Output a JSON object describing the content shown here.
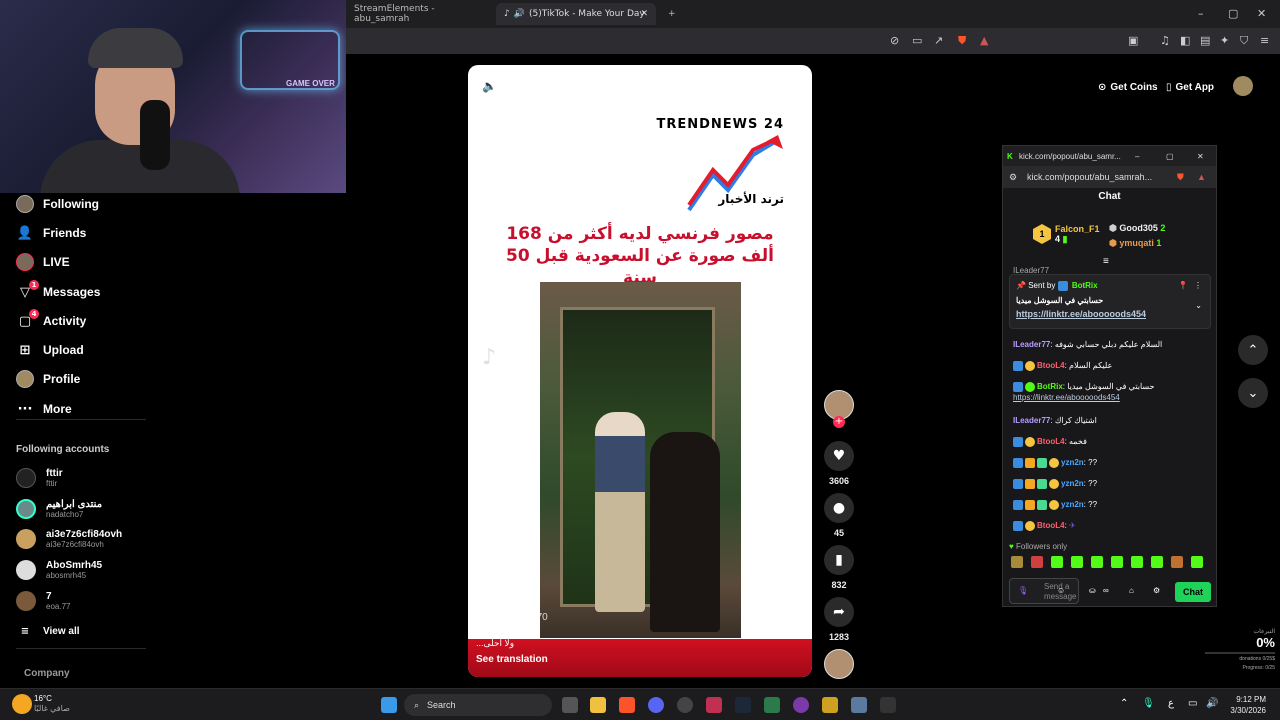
{
  "browser": {
    "tabs": [
      {
        "label": "StreamElements - abu_samrah"
      },
      {
        "label": "(5)TikTok - Make Your Day"
      }
    ],
    "add_tab": "+"
  },
  "webcam": {
    "overlay_text": "GAME OVER"
  },
  "sidebar": {
    "items": [
      {
        "label": "Following",
        "icon": "avatar-icon"
      },
      {
        "label": "Friends",
        "icon": "friends-icon"
      },
      {
        "label": "LIVE",
        "icon": "live-icon"
      },
      {
        "label": "Messages",
        "icon": "messages-icon",
        "badge": "1"
      },
      {
        "label": "Activity",
        "icon": "activity-icon",
        "badge": "4"
      },
      {
        "label": "Upload",
        "icon": "upload-icon"
      },
      {
        "label": "Profile",
        "icon": "profile-icon"
      },
      {
        "label": "More",
        "icon": "more-icon"
      }
    ],
    "following_title": "Following accounts",
    "accounts": [
      {
        "name": "fttir",
        "handle": "fttir"
      },
      {
        "name": "منتدى ابراهيم",
        "handle": "nadatcho7"
      },
      {
        "name": "ai3e7z6cfi84ovh",
        "handle": "ai3e7z6cfi84ovh"
      },
      {
        "name": "AboSmrh45",
        "handle": "abosmrh45"
      },
      {
        "name": "7",
        "handle": "eoa.77"
      }
    ],
    "view_all": "View all",
    "company": "Company"
  },
  "video": {
    "brand": "TRENDNEWS 24",
    "brand_ar": "ترند الأخبار",
    "headline": "مصور فرنسي لديه أكثر من 168 ألف صورة عن السعودية قبل 50 سنة",
    "caption": "...ولا احلى",
    "watermark": "abu_dommes70",
    "see_translation": "See translation"
  },
  "actions": {
    "likes": "3606",
    "comments": "45",
    "saves": "832",
    "shares": "1283"
  },
  "topbar": {
    "get_coins": "Get Coins",
    "get_app": "Get App"
  },
  "chat": {
    "window_title": "kick.com/popout/abu_samr...",
    "url": "kick.com/popout/abu_samrah...",
    "header": "Chat",
    "leaderboard": [
      {
        "name": "Falcon_F1",
        "count": "4",
        "color": "#f5c542"
      },
      {
        "name": "Good305",
        "count": "2",
        "color": "#cfcfcf"
      },
      {
        "name": "ymuqati",
        "count": "1",
        "color": "#e89a4a"
      }
    ],
    "scrolled_text": "ILeader77",
    "pinned": {
      "sent_by_label": "Sent by",
      "sender": "BotRix",
      "text": "حسابتي في السوشل ميديا",
      "link": "https://linktr.ee/abooooods454"
    },
    "messages": [
      {
        "user": "ILeader77",
        "color": "#b89cff",
        "text": "السلام عليكم دبلي حسابي شوفه"
      },
      {
        "user": "BtooL4",
        "color": "#ff5f6d",
        "text": "عليكم السلام"
      },
      {
        "user": "BotRix",
        "color": "#53fc18",
        "text": "حسابتي في السوشل ميديا",
        "link": "https://linktr.ee/abooooods454"
      },
      {
        "user": "ILeader77",
        "color": "#b89cff",
        "text": "اشتياك كراك"
      },
      {
        "user": "BtooL4",
        "color": "#ff5f6d",
        "text": "فخمه"
      },
      {
        "user": "yzn2n",
        "color": "#4aa8ff",
        "text": "??"
      },
      {
        "user": "yzn2n",
        "color": "#4aa8ff",
        "text": "??"
      },
      {
        "user": "yzn2n",
        "color": "#4aa8ff",
        "text": "??"
      },
      {
        "user": "BtooL4",
        "color": "#ff5f6d",
        "text": ""
      }
    ],
    "followers_only": "Followers only",
    "input_placeholder": "Send a message",
    "send_label": "Chat"
  },
  "donations": {
    "label": "التبرعات",
    "percent": "0%",
    "donations": "donations 0/25$",
    "progress": "Progress: 0/25"
  },
  "taskbar": {
    "weather_temp": "16°C",
    "weather_desc": "صافي غالبًا",
    "search": "Search",
    "time": "9:12 PM",
    "date": "3/30/2026",
    "lang": "ع"
  }
}
